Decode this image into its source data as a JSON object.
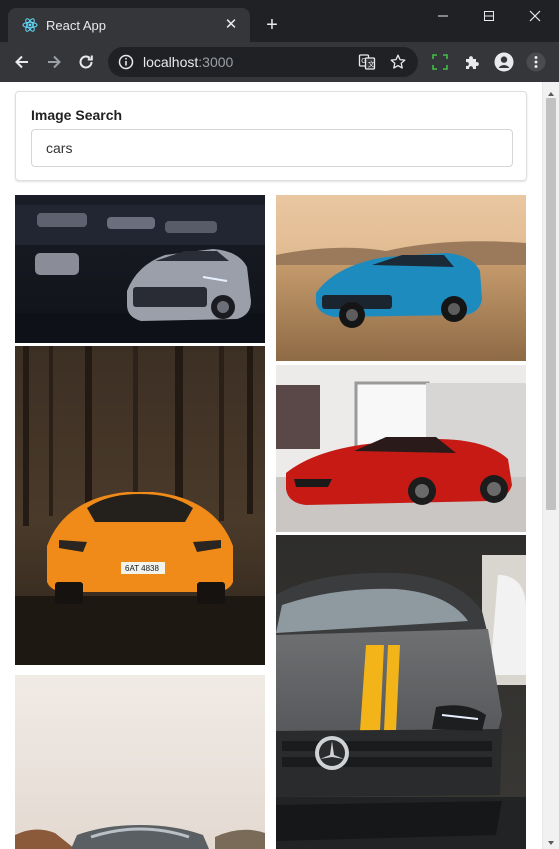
{
  "browser": {
    "tab_title": "React App",
    "url_host": "localhost",
    "url_port": ":3000"
  },
  "app": {
    "search": {
      "label": "Image Search",
      "value": "cars"
    },
    "results": [
      {
        "id": "grey-camaro-garage"
      },
      {
        "id": "blue-camaro-desert"
      },
      {
        "id": "orange-lamborghini-forest"
      },
      {
        "id": "red-ferrari-showroom"
      },
      {
        "id": "silver-car-partial"
      },
      {
        "id": "grey-mercedes-yellow-stripe"
      }
    ]
  },
  "icons": [
    "react-logo-icon",
    "close-icon",
    "plus-icon",
    "minimize-icon",
    "maximize-icon",
    "back-icon",
    "forward-icon",
    "reload-icon",
    "info-icon",
    "translate-icon",
    "star-icon",
    "extension-icon",
    "puzzle-icon",
    "profile-icon",
    "menu-icon"
  ],
  "colors": {
    "chrome_dark": "#202124",
    "chrome_tab": "#35363a",
    "page_bg": "#ffffff"
  }
}
